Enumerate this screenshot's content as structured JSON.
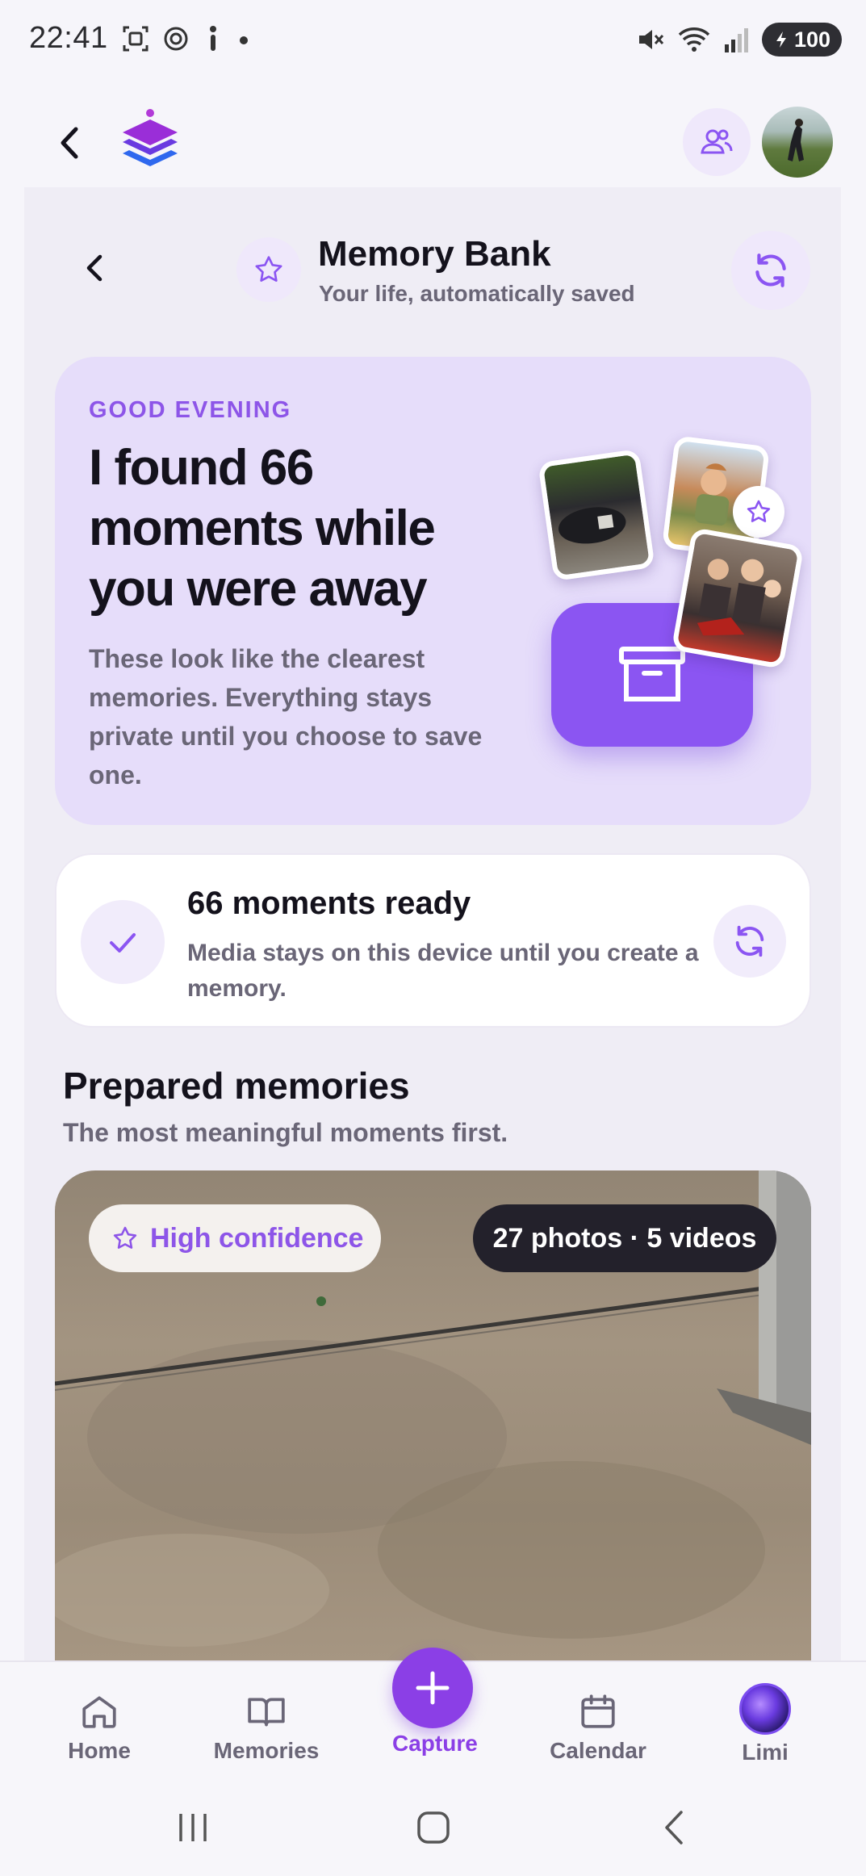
{
  "status_bar": {
    "time": "22:41",
    "battery": "100",
    "icons": [
      "screenshot-icon",
      "openai-icon",
      "accessibility-icon",
      "dot-icon",
      "mute-icon",
      "wifi-icon",
      "signal-icon",
      "battery-icon"
    ]
  },
  "app_bar": {
    "logo": "layers-logo",
    "people_icon": "people-icon",
    "avatar": "profile-avatar"
  },
  "header": {
    "title": "Memory Bank",
    "subtitle": "Your life, automatically saved"
  },
  "hero": {
    "eyebrow": "GOOD EVENING",
    "heading": "I found 66 moments while you were away",
    "body": "These look like the clearest memories. Everything stays private until you choose to save one."
  },
  "status_card": {
    "title": "66 moments ready",
    "description": "Media stays on this device until you create a memory."
  },
  "prepared": {
    "title": "Prepared memories",
    "subtitle": "The most meaningful moments first."
  },
  "memory_card": {
    "confidence": "High confidence",
    "count": "27 photos · 5 videos"
  },
  "bottom_nav": {
    "items": [
      {
        "label": "Home",
        "icon": "home-icon"
      },
      {
        "label": "Memories",
        "icon": "book-icon"
      },
      {
        "label": "Capture",
        "icon": "plus-icon"
      },
      {
        "label": "Calendar",
        "icon": "calendar-icon"
      },
      {
        "label": "Limi",
        "icon": "limi-orb-icon"
      }
    ]
  },
  "colors": {
    "accent": "#8b55f2",
    "accent_dark": "#8b3fe6",
    "hero_bg": "#e6ddfa",
    "muted_text": "#6a6677"
  }
}
